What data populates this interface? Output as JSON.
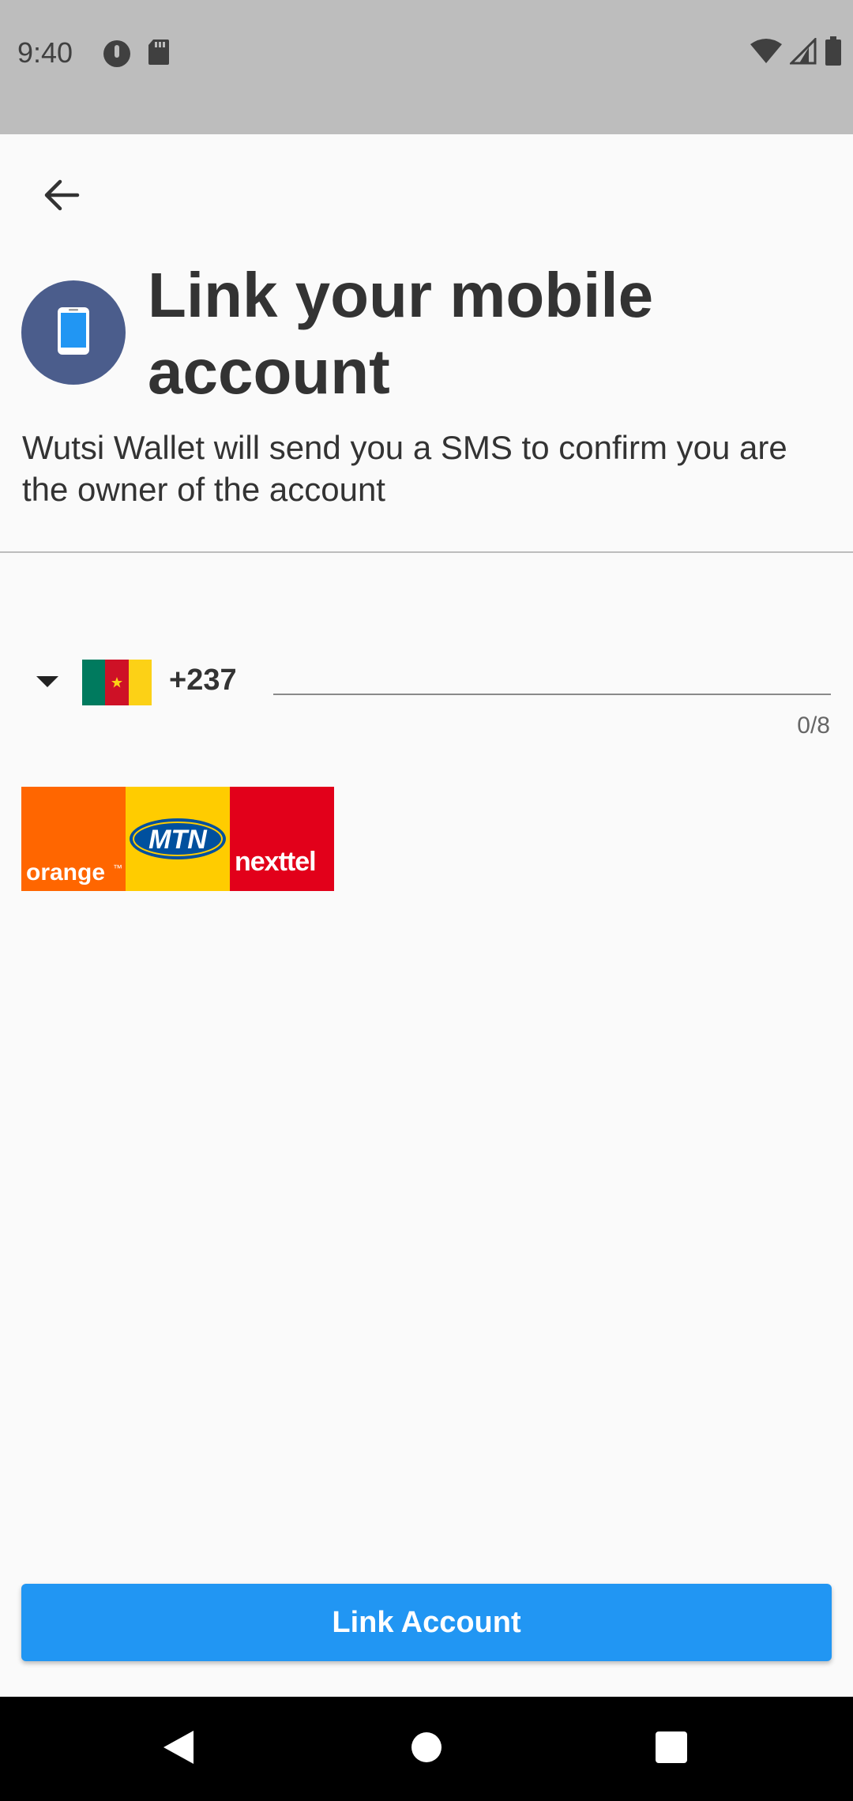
{
  "status_bar": {
    "time": "9:40",
    "left_icons": [
      "data-saver-icon",
      "sd-card-icon"
    ],
    "right_icons": [
      "wifi-icon",
      "signal-icon",
      "battery-icon"
    ]
  },
  "header": {
    "title": "Link your mobile account",
    "subtitle": "Wutsi Wallet will send you a SMS to confirm you are the owner of the account",
    "avatar_icon": "smartphone-icon"
  },
  "phone": {
    "country_flag": "cameroon-flag",
    "dial_code": "+237",
    "value": "",
    "placeholder": "",
    "counter": "0/8"
  },
  "operators": {
    "orange_label": "orange",
    "orange_tm": "™",
    "mtn_label": "MTN",
    "nexttel_label": "nexttel"
  },
  "actions": {
    "link_label": "Link Account"
  },
  "colors": {
    "accent": "#2196f3",
    "avatar_bg": "#4b5d8c",
    "status_bar": "#bdbdbd",
    "orange": "#ff6600",
    "mtn": "#ffcc00",
    "nexttel": "#e2001a"
  }
}
